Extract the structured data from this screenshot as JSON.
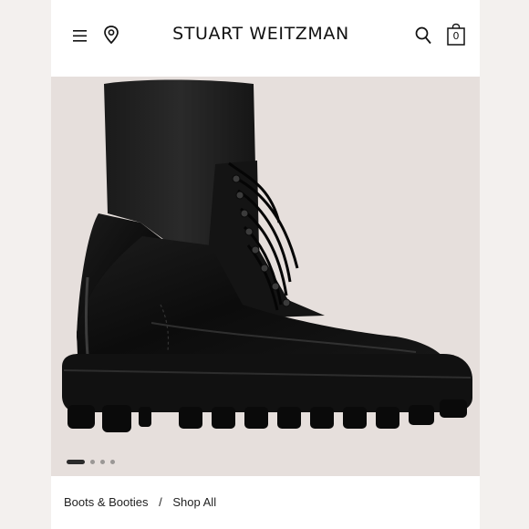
{
  "header": {
    "brand": "STUART WEITZMAN",
    "bag_count": "0",
    "icons": [
      "menu-icon",
      "location-pin-icon",
      "search-icon",
      "shopping-bag-icon"
    ]
  },
  "gallery": {
    "image": "black-lace-up-combat-boot",
    "slide_count": 4,
    "active_slide": 1
  },
  "breadcrumb": {
    "items": [
      "Boots & Booties",
      "Shop All"
    ],
    "separator": "/"
  },
  "colors": {
    "background": "#f3f0ee",
    "image_background": "#e6dfdc",
    "text": "#111111"
  }
}
